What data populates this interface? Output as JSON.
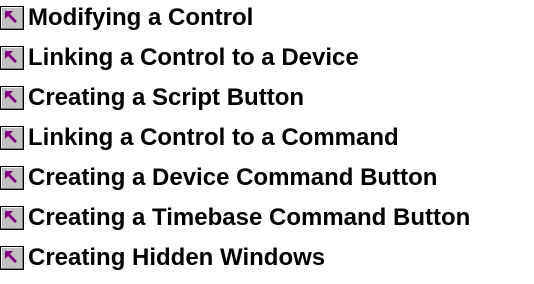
{
  "topics": [
    {
      "label": "Modifying a Control",
      "icon": "jump-arrow-icon"
    },
    {
      "label": "Linking a Control to a Device",
      "icon": "jump-arrow-icon"
    },
    {
      "label": "Creating a Script Button",
      "icon": "jump-arrow-icon"
    },
    {
      "label": "Linking a Control to a Command",
      "icon": "jump-arrow-icon"
    },
    {
      "label": "Creating a Device Command Button",
      "icon": "jump-arrow-icon"
    },
    {
      "label": "Creating a Timebase Command Button",
      "icon": "jump-arrow-icon"
    },
    {
      "label": "Creating Hidden Windows",
      "icon": "jump-arrow-icon"
    }
  ],
  "colors": {
    "icon_face": "#c0c0c0",
    "icon_arrow": "#800080",
    "icon_shadow": "#808080",
    "text": "#000000"
  }
}
